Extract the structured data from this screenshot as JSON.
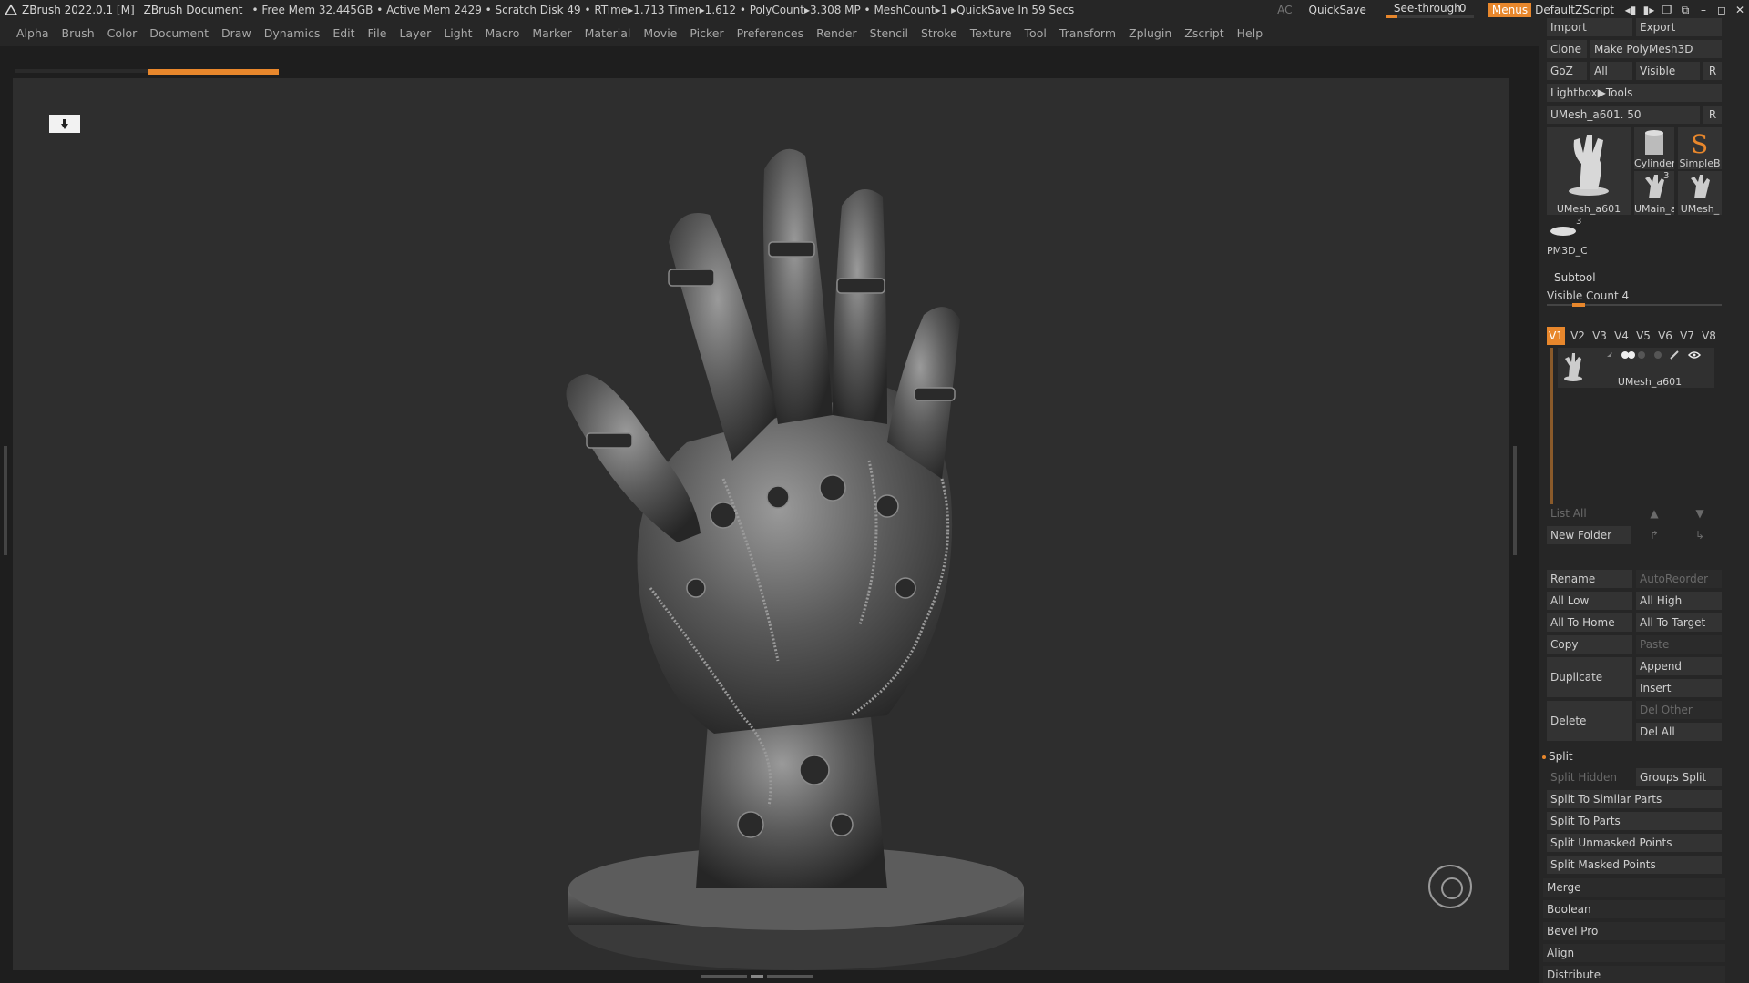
{
  "titlebar": {
    "app": "ZBrush 2022.0.1 [M]",
    "document": "ZBrush Document",
    "stats": "• Free Mem 32.445GB • Active Mem 2429 • Scratch Disk 49 •  RTime▸1.713 Timer▸1.612 • PolyCount▸3.308 MP  • MeshCount▸1  ▸QuickSave In 59 Secs",
    "ac": "AC",
    "quicksave": "QuickSave",
    "see_through_label": "See-through",
    "see_through_value": "0",
    "menus": "Menus",
    "default_zscript": "DefaultZScript"
  },
  "menubar": [
    "Alpha",
    "Brush",
    "Color",
    "Document",
    "Draw",
    "Dynamics",
    "Edit",
    "File",
    "Layer",
    "Light",
    "Macro",
    "Marker",
    "Material",
    "Movie",
    "Picker",
    "Preferences",
    "Render",
    "Stencil",
    "Stroke",
    "Texture",
    "Tool",
    "Transform",
    "Zplugin",
    "Zscript",
    "Help"
  ],
  "tool": {
    "import": "Import",
    "export": "Export",
    "clone": "Clone",
    "make_polymesh": "Make PolyMesh3D",
    "goz": "GoZ",
    "all": "All",
    "visible": "Visible",
    "r": "R",
    "lightbox_tools": "Lightbox▶Tools",
    "current_tool": "UMesh_a601. 50",
    "thumbs": {
      "main": "UMesh_a601",
      "cylinder": "Cylinder",
      "simpleb": "SimpleB",
      "umain": "UMain_a",
      "umesh": "UMesh_",
      "pm3d": "PM3D_C",
      "umain_count": "3",
      "pm3d_count": "3"
    }
  },
  "subtool": {
    "title": "Subtool",
    "visible_count": "Visible Count 4",
    "tabs": [
      "V1",
      "V2",
      "V3",
      "V4",
      "V5",
      "V6",
      "V7",
      "V8"
    ],
    "item_name": "UMesh_a601",
    "list_all": "List All",
    "new_folder": "New Folder",
    "rename": "Rename",
    "autoreorder": "AutoReorder",
    "all_low": "All Low",
    "all_high": "All High",
    "all_to_home": "All To Home",
    "all_to_target": "All To Target",
    "copy": "Copy",
    "paste": "Paste",
    "duplicate": "Duplicate",
    "append": "Append",
    "insert": "Insert",
    "delete": "Delete",
    "del_other": "Del Other",
    "del_all": "Del All",
    "split": "Split",
    "split_hidden": "Split Hidden",
    "groups_split": "Groups Split",
    "split_similar": "Split To Similar Parts",
    "split_parts": "Split To Parts",
    "split_unmasked": "Split Unmasked Points",
    "split_masked": "Split Masked Points",
    "merge": "Merge",
    "boolean": "Boolean",
    "bevel_pro": "Bevel Pro",
    "align": "Align",
    "distribute": "Distribute"
  },
  "colors": {
    "accent": "#e8872c",
    "panel": "#262626",
    "viewport": "#2e2e2e"
  }
}
